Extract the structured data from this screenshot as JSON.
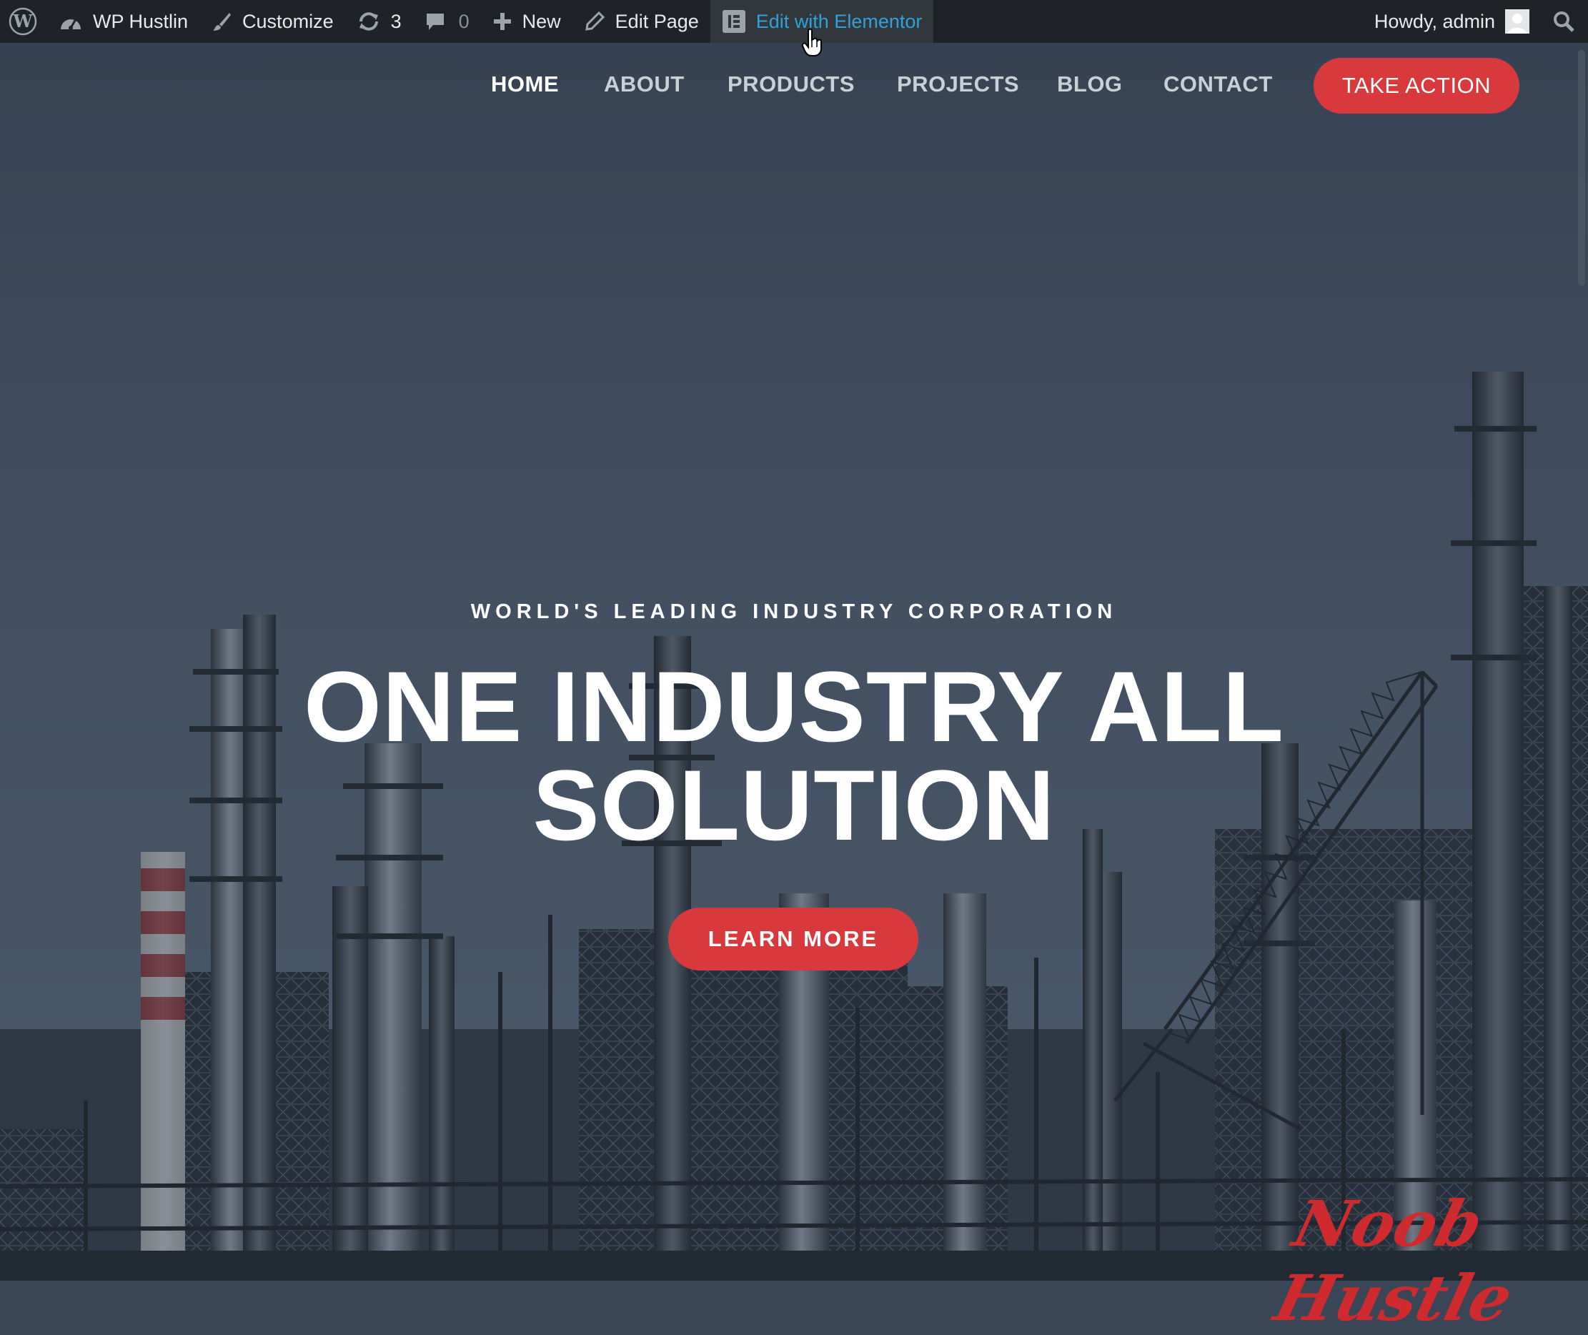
{
  "admin_bar": {
    "site_name": "WP Hustlin",
    "customize": "Customize",
    "updates_count": "3",
    "comments_count": "0",
    "new": "New",
    "edit_page": "Edit Page",
    "edit_elementor": "Edit with Elementor",
    "greeting": "Howdy, admin"
  },
  "nav": {
    "items": [
      "HOME",
      "ABOUT",
      "PRODUCTS",
      "PROJECTS",
      "BLOG",
      "CONTACT"
    ],
    "active": "HOME",
    "cta": "TAKE ACTION"
  },
  "hero": {
    "eyebrow": "WORLD'S LEADING INDUSTRY CORPORATION",
    "headline_line1": "ONE INDUSTRY ALL",
    "headline_line2": "SOLUTION",
    "button": "LEARN MORE",
    "watermark": "Noob Hustle"
  },
  "colors": {
    "admin_bar_bg": "#1f2328",
    "elementor_link": "#2ea2dc",
    "accent_red": "#d8393c",
    "sky_top": "#3b4757",
    "sky_bottom": "#4f6072"
  },
  "icons": [
    "wordpress-icon",
    "dashboard-icon",
    "brush-icon",
    "refresh-icon",
    "comment-icon",
    "plus-icon",
    "pencil-icon",
    "elementor-icon",
    "avatar-icon",
    "search-icon",
    "hand-cursor-icon"
  ]
}
